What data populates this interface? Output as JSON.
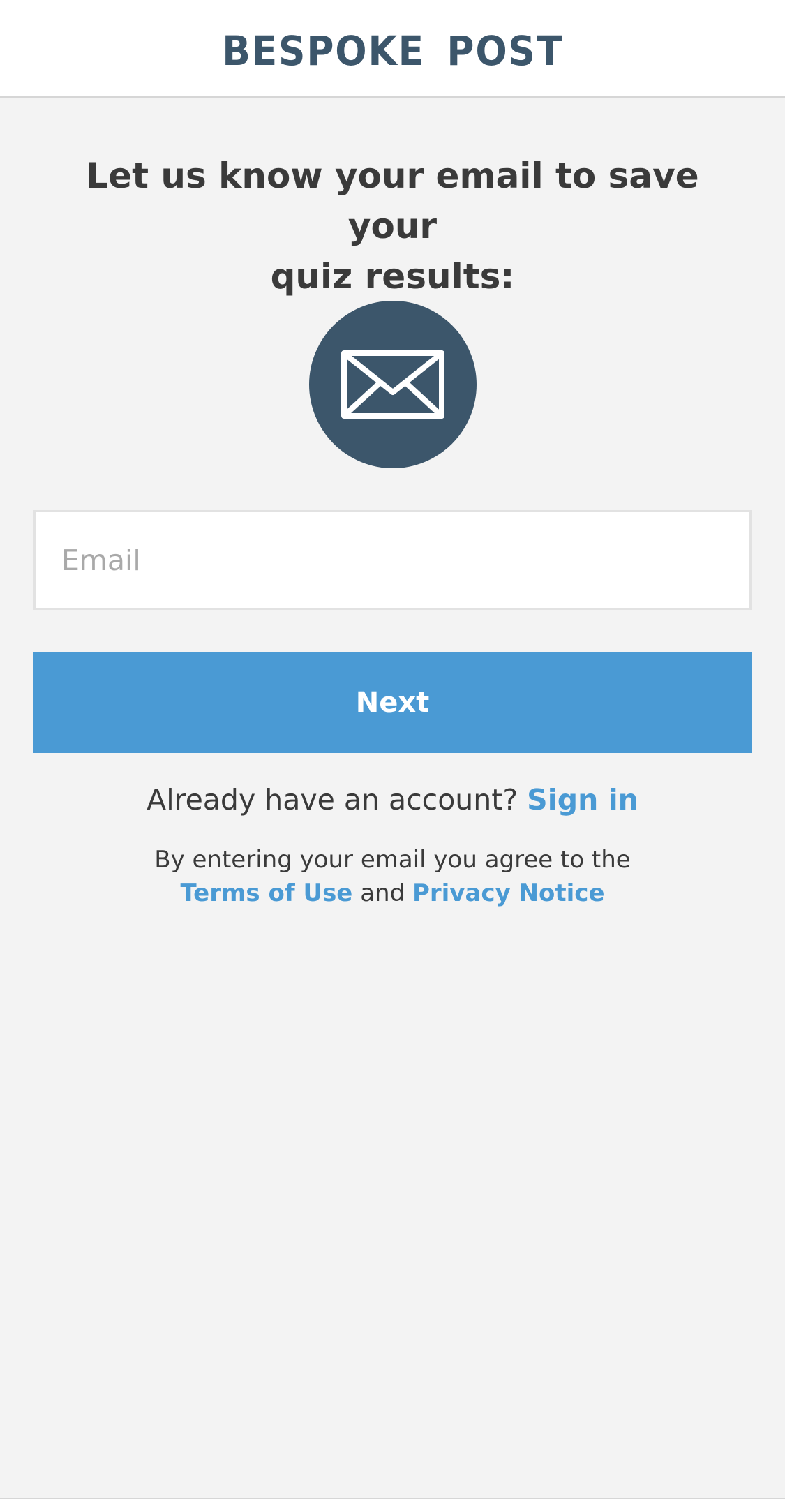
{
  "header": {
    "logo_text": "BESPOKE POST"
  },
  "main": {
    "heading_line1": "Let us know your email to save your",
    "heading_line2": "quiz results:",
    "icon": "envelope-icon",
    "email_field": {
      "placeholder": "Email",
      "value": ""
    },
    "next_label": "Next",
    "account_prompt": "Already have an account?",
    "sign_in_label": "Sign in",
    "legal_prefix": "By entering your email you agree to the",
    "terms_label": "Terms of Use",
    "legal_and": "and",
    "privacy_label": "Privacy Notice"
  },
  "colors": {
    "brand": "#3c566b",
    "accent": "#4a9ad4",
    "background": "#f3f3f3",
    "text": "#3a3a3a"
  }
}
